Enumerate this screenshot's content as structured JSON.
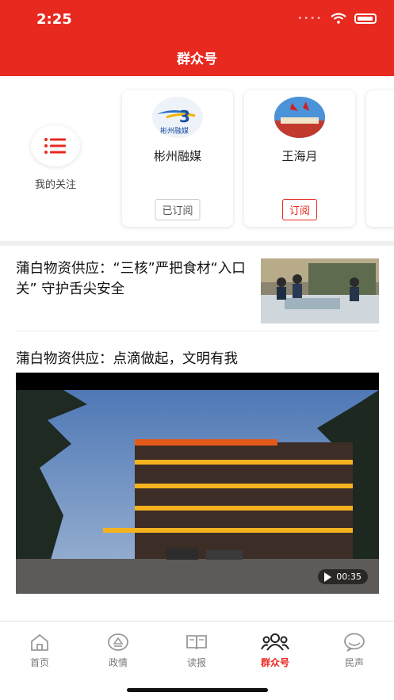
{
  "status_bar": {
    "time": "2:25"
  },
  "header": {
    "title": "群众号"
  },
  "follow": {
    "my_follow_label": "我的关注",
    "cards": [
      {
        "name": "彬州融媒",
        "button": "已订阅",
        "logo_text": "彬州融媒"
      },
      {
        "name": "王海月",
        "button": "订阅"
      }
    ]
  },
  "feed": {
    "article1": {
      "title": "蒲白物资供应：“三核”严把食材“入口关” 守护舌尖安全"
    },
    "article2": {
      "title": "蒲白物资供应：点滴做起，文明有我",
      "duration": "00:35"
    }
  },
  "tabbar": {
    "tabs": [
      {
        "label": "首页"
      },
      {
        "label": "政情"
      },
      {
        "label": "读报"
      },
      {
        "label": "群众号"
      },
      {
        "label": "民声"
      }
    ]
  },
  "colors": {
    "accent": "#e8291f"
  }
}
